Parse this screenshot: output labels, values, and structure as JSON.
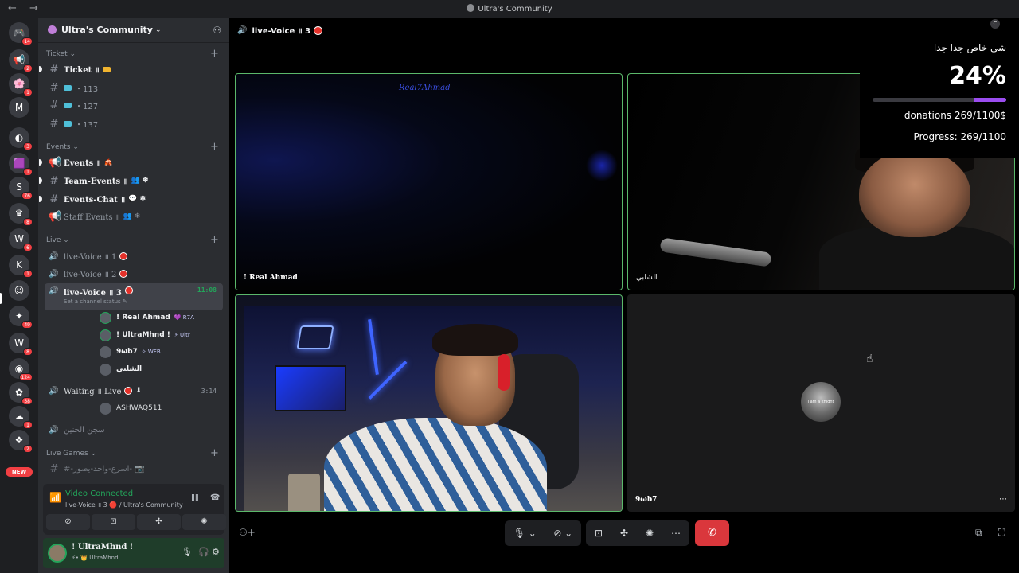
{
  "titlebar": {
    "title": "Ultra's Community",
    "nav": "← →"
  },
  "servers": [
    {
      "glyph": "🎮",
      "badge": "14"
    },
    {
      "glyph": "📢",
      "badge": "2"
    },
    {
      "glyph": "🌸",
      "badge": "1"
    },
    {
      "glyph": "M",
      "badge": ""
    },
    {
      "glyph": "◐",
      "badge": "3"
    },
    {
      "glyph": "🟪",
      "badge": "1"
    },
    {
      "glyph": "S",
      "badge": "76"
    },
    {
      "glyph": "♛",
      "badge": "8"
    },
    {
      "glyph": "W",
      "badge": "6"
    },
    {
      "glyph": "K",
      "badge": "1"
    },
    {
      "glyph": "☺",
      "badge": ""
    },
    {
      "glyph": "✦",
      "badge": "49"
    },
    {
      "glyph": "W",
      "badge": "8"
    },
    {
      "glyph": "◉",
      "badge": "124"
    },
    {
      "glyph": "✿",
      "badge": "38"
    },
    {
      "glyph": "☁",
      "badge": "1"
    },
    {
      "glyph": "❖",
      "badge": "2"
    }
  ],
  "new_badge": "NEW",
  "guild": {
    "name": "Ultra's Community"
  },
  "categories": {
    "ticket": "Ticket",
    "events": "Events",
    "live": "Live",
    "live_games": "Live Games"
  },
  "channels": {
    "ticket_main": {
      "name": "Ticket ॥"
    },
    "ticket_113": {
      "name": "・113"
    },
    "ticket_127": {
      "name": "・127"
    },
    "ticket_137": {
      "name": "・137"
    },
    "events": {
      "name": "Events ॥",
      "emoji": "🎪"
    },
    "team_events": {
      "name": "Team-Events ॥",
      "emoji": "👥 ❄"
    },
    "events_chat": {
      "name": "Events-Chat ॥",
      "emoji": "💬 ❄"
    },
    "staff_events": {
      "name": "Staff Events ॥",
      "emoji": "👥 ❄"
    },
    "live_voice_1": {
      "name": "live-Voice ॥ 1"
    },
    "live_voice_2": {
      "name": "live-Voice ॥ 2"
    },
    "live_voice_3": {
      "name": "live-Voice ॥ 3",
      "timer": "11:08",
      "status": "Set a channel status ✎"
    },
    "waiting": {
      "name": "Waiting ॥ Live",
      "timer": "3:14"
    },
    "prison": {
      "name": "سجن الحنين"
    },
    "game_channel": {
      "name": "#-اسرع-واحد-يصور- 📷"
    }
  },
  "voice_users": [
    {
      "name": "! Real Ahmad",
      "tag": "💜 R7A"
    },
    {
      "name": "! UltraMhnd !",
      "tag": "⚡ Ultr"
    },
    {
      "name": "9ωb7",
      "tag": "✧ WFB"
    },
    {
      "name": "الشلبي",
      "tag": ""
    }
  ],
  "waiting_user": {
    "name": "ASHWAQ511"
  },
  "voice_panel": {
    "status": "Video Connected",
    "channel": "live-Voice ॥ 3 🔴 / Ultra's Community",
    "buttons": [
      "⊘",
      "⊡",
      "✣",
      "✺"
    ]
  },
  "user_panel": {
    "name": "! UltraMhnd !",
    "sub": "⚡• 👑 UltraMhnd"
  },
  "main": {
    "channel_title": "live-Voice ॥ 3",
    "tiles": [
      {
        "label": "! Real Ahmad",
        "overlay_text": "Real7Ahmad"
      },
      {
        "label": "الشلبي"
      },
      {
        "label": ""
      },
      {
        "label": "9ωb7",
        "avatar_text": "I am a knight"
      }
    ]
  },
  "donation": {
    "goal_title": "شي خاص جدا جدا",
    "percent": "24%",
    "progress_fraction": 0.24,
    "donations_text": "donations 269/1100$",
    "progress_text": "Progress: 269/1100",
    "accent": "#9b4df0"
  },
  "controls": {
    "mic": "🎙 ⌄",
    "camera": "⊘ ⌄",
    "screen": "⊡",
    "activities": "✣",
    "soundboard": "✺",
    "more": "⋯",
    "leave": "✆"
  },
  "colors": {
    "speaking": "#5bb86a",
    "live": "#e4312a",
    "connected": "#23a55a",
    "leave": "#da373c"
  }
}
